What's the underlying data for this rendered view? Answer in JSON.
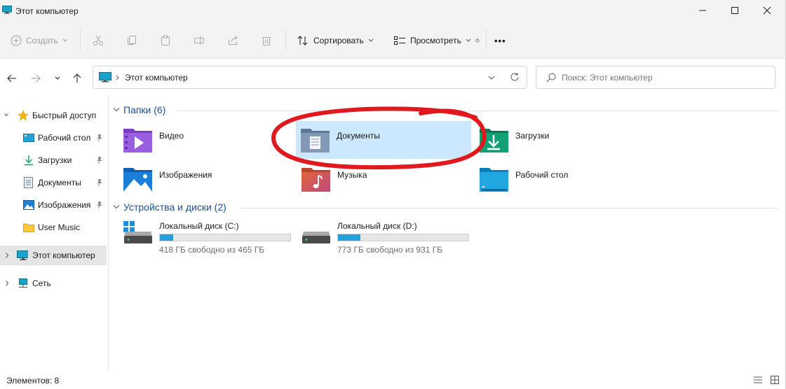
{
  "window": {
    "title": "Этот компьютер"
  },
  "toolbar": {
    "create_label": "Создать",
    "sort_label": "Сортировать",
    "view_label": "Просмотреть",
    "more_label": "•••"
  },
  "address": {
    "path": "Этот компьютер"
  },
  "search": {
    "placeholder": "Поиск: Этот компьютер"
  },
  "sidebar": {
    "quick_access": "Быстрый доступ",
    "items": [
      {
        "label": "Рабочий стол",
        "icon": "desktop-icon",
        "pinned": true
      },
      {
        "label": "Загрузки",
        "icon": "download-icon",
        "pinned": true
      },
      {
        "label": "Документы",
        "icon": "documents-icon",
        "pinned": true
      },
      {
        "label": "Изображения",
        "icon": "pictures-icon",
        "pinned": true
      },
      {
        "label": "User Music",
        "icon": "folder-icon",
        "pinned": false
      }
    ],
    "this_pc": "Этот компьютер",
    "network": "Сеть"
  },
  "folders": {
    "heading": "Папки (6)",
    "items": [
      {
        "label": "Видео",
        "icon": "videos-folder-icon"
      },
      {
        "label": "Документы",
        "icon": "documents-folder-icon",
        "selected": true
      },
      {
        "label": "Загрузки",
        "icon": "downloads-folder-icon"
      },
      {
        "label": "Изображения",
        "icon": "pictures-folder-icon"
      },
      {
        "label": "Музыка",
        "icon": "music-folder-icon"
      },
      {
        "label": "Рабочий стол",
        "icon": "desktop-folder-icon"
      }
    ]
  },
  "drives": {
    "heading": "Устройства и диски (2)",
    "items": [
      {
        "label": "Локальный диск (C:)",
        "free_text": "418 ГБ свободно из 465 ГБ",
        "used_fraction": 0.101
      },
      {
        "label": "Локальный диск (D:)",
        "free_text": "773 ГБ свободно из 931 ГБ",
        "used_fraction": 0.17
      }
    ]
  },
  "status": {
    "items_count": "Элементов: 8"
  },
  "colors": {
    "accent": "#26a0da",
    "selection": "#cce8ff",
    "group_heading": "#1e4e96",
    "annotation": "#e0191f"
  }
}
